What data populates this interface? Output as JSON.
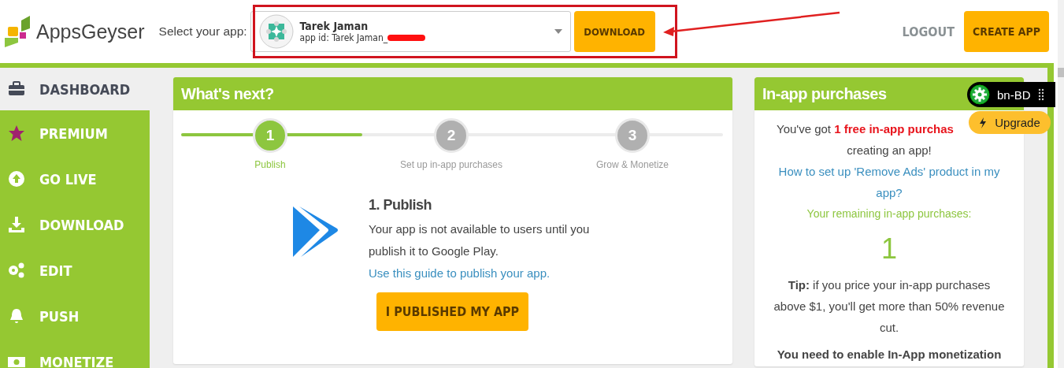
{
  "header": {
    "logo_text": "AppsGeyser",
    "select_label": "Select your app:",
    "app_select": {
      "name": "Tarek Jaman",
      "app_id": "app id: Tarek Jaman_"
    },
    "download_button": "DOWNLOAD",
    "logout_link": "LOGOUT",
    "create_button": "CREATE APP"
  },
  "sidebar": {
    "items": [
      {
        "label": "DASHBOARD",
        "selected": true
      },
      {
        "label": "PREMIUM",
        "selected": false
      },
      {
        "label": "GO LIVE",
        "selected": false
      },
      {
        "label": "DOWNLOAD",
        "selected": false
      },
      {
        "label": "EDIT",
        "selected": false
      },
      {
        "label": "PUSH",
        "selected": false
      },
      {
        "label": "MONETIZE",
        "selected": false
      }
    ]
  },
  "whats_next": {
    "title": "What's next?",
    "progress": {
      "level": 0.335
    },
    "steps": [
      {
        "number": "1",
        "label": "Publish",
        "selected": true
      },
      {
        "number": "2",
        "label": "Set up in-app purchases",
        "selected": false
      },
      {
        "number": "3",
        "label": "Grow & Monetize",
        "selected": false
      }
    ],
    "heading": "1. Publish",
    "text": "Your app is not available to users until you publish it to Google Play.",
    "link": "Use this guide to publish your app.",
    "button": "I PUBLISHED MY APP"
  },
  "in_app": {
    "title": "In-app purchases",
    "intro": "You've got **1 free in-app purchas**",
    "intro_end": "creating an app!",
    "link": "How to set up 'Remove Ads' product in my app?",
    "remaining_label": "Your remaining in-app purchases:",
    "remaining": "1",
    "tip": "**Tip:** if you price your in-app purchases above $1, you'll get more than 50% revenue cut.",
    "notice": "You need to enable In-App monetization"
  },
  "extension": {
    "language": "bn-BD",
    "upgrade": "Upgrade"
  }
}
